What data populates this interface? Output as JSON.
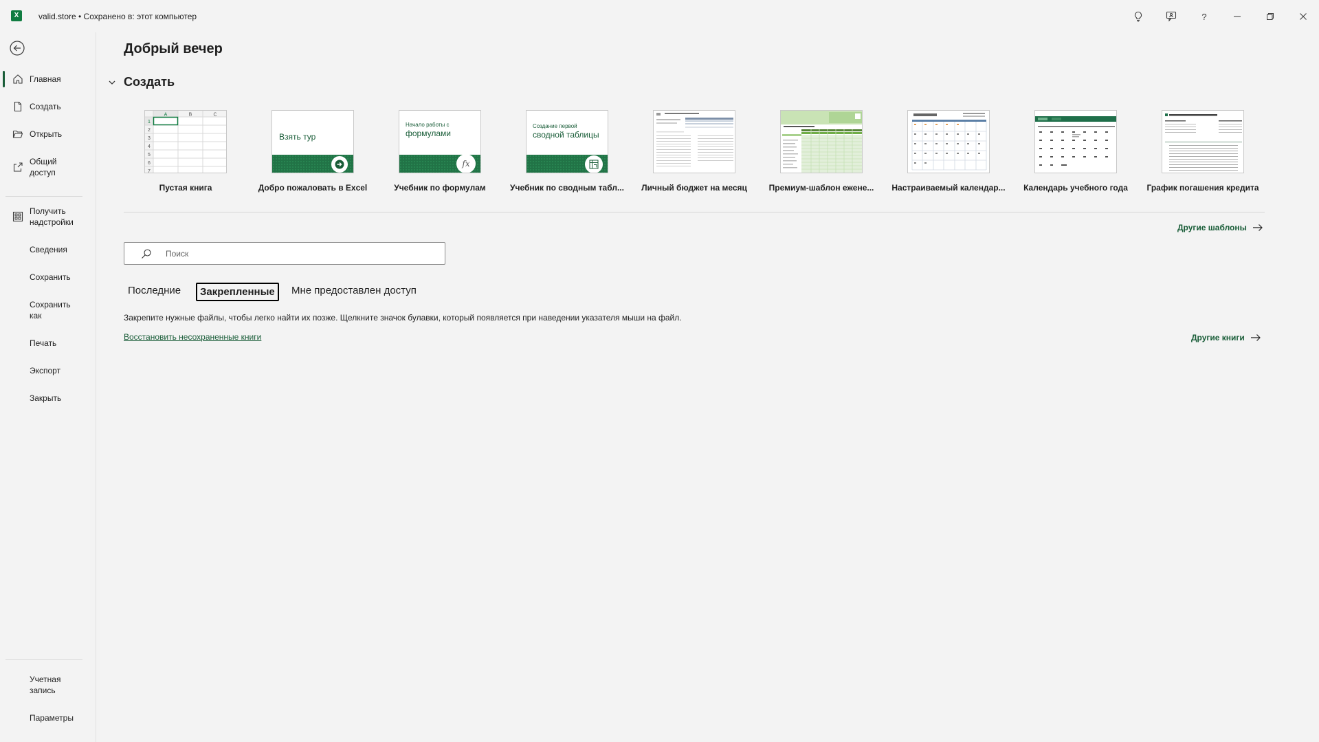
{
  "titlebar": {
    "app_icon": "excel-logo",
    "app_letter": "X",
    "doc_title": "valid.store • Сохранено в: этот компьютер",
    "icons": [
      "lightbulb-icon",
      "feedback-icon",
      "help-icon",
      "minimize-icon",
      "restore-icon",
      "close-icon"
    ],
    "help_glyph": "?"
  },
  "sidebar": {
    "back_icon": "back-arrow-icon",
    "items": [
      {
        "label": "Главная",
        "icon": "home-icon",
        "active": true
      },
      {
        "label": "Создать",
        "icon": "new-document-icon"
      },
      {
        "label": "Открыть",
        "icon": "folder-open-icon"
      },
      {
        "label": "Общий доступ",
        "icon": "share-icon"
      },
      {
        "label": "Получить надстройки",
        "icon": "addins-icon"
      },
      {
        "label": "Сведения"
      },
      {
        "label": "Сохранить"
      },
      {
        "label": "Сохранить как"
      },
      {
        "label": "Печать"
      },
      {
        "label": "Экспорт"
      },
      {
        "label": "Закрыть"
      }
    ],
    "bottom_items": [
      {
        "label": "Учетная запись"
      },
      {
        "label": "Параметры"
      }
    ]
  },
  "main": {
    "greeting": "Добрый вечер",
    "create_section": "Создать",
    "templates": [
      {
        "caption": "Пустая книга",
        "thumb_text": ""
      },
      {
        "caption": "Добро пожаловать в Excel",
        "thumb_text": "Взять тур"
      },
      {
        "caption": "Учебник по формулам",
        "thumb_text_small": "Начало работы с",
        "thumb_text": "формулами"
      },
      {
        "caption": "Учебник по сводным табл...",
        "thumb_text_small": "Создание первой",
        "thumb_text": "сводной таблицы"
      },
      {
        "caption": "Личный бюджет на месяц"
      },
      {
        "caption": "Премиум-шаблон ежене..."
      },
      {
        "caption": "Настраиваемый календар..."
      },
      {
        "caption": "Календарь учебного года"
      },
      {
        "caption": "График погашения кредита"
      }
    ],
    "blank_grid": {
      "cols": [
        "A",
        "B",
        "C"
      ],
      "rows": [
        "1",
        "2",
        "3",
        "4",
        "5",
        "6",
        "7"
      ]
    },
    "more_templates": "Другие шаблоны",
    "search_placeholder": "Поиск",
    "tabs": [
      {
        "label": "Последние",
        "selected": false
      },
      {
        "label": "Закрепленные",
        "selected": true
      },
      {
        "label": "Мне предоставлен доступ",
        "selected": false
      }
    ],
    "pinned_info": "Закрепите нужные файлы, чтобы легко найти их позже. Щелкните значок булавки, который появляется при наведении указателя мыши на файл.",
    "restore_link": "Восстановить несохраненные книги",
    "more_books": "Другие книги"
  },
  "colors": {
    "accent": "#185c37",
    "excel_green": "#107c41"
  }
}
